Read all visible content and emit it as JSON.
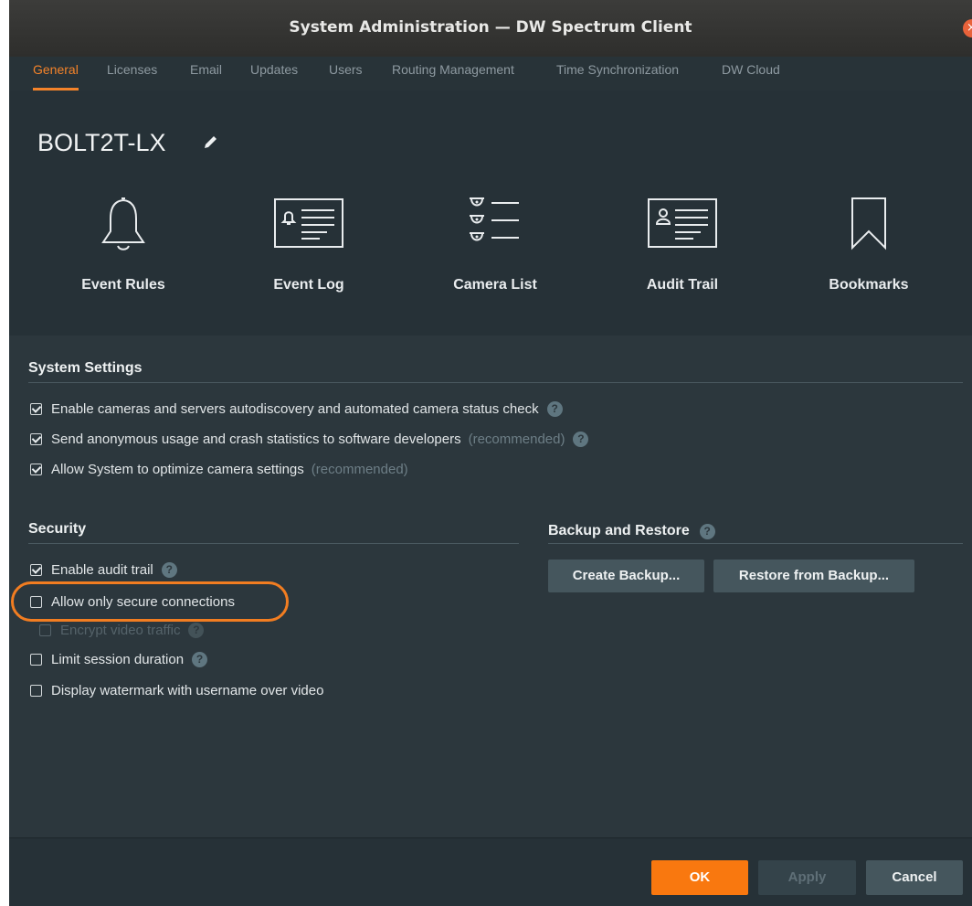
{
  "window": {
    "title": "System Administration — DW Spectrum Client",
    "close_glyph": "×"
  },
  "tabs": [
    {
      "label": "General",
      "active": true
    },
    {
      "label": "Licenses"
    },
    {
      "label": "Email"
    },
    {
      "label": "Updates"
    },
    {
      "label": "Users"
    },
    {
      "label": "Routing Management"
    },
    {
      "label": "Time Synchronization"
    },
    {
      "label": "DW Cloud"
    }
  ],
  "header": {
    "system_name": "BOLT2T-LX",
    "tiles": [
      {
        "label": "Event Rules",
        "icon": "bell-icon"
      },
      {
        "label": "Event Log",
        "icon": "event-log-icon"
      },
      {
        "label": "Camera List",
        "icon": "camera-list-icon"
      },
      {
        "label": "Audit Trail",
        "icon": "audit-trail-icon"
      },
      {
        "label": "Bookmarks",
        "icon": "bookmark-icon"
      }
    ]
  },
  "system_settings": {
    "title": "System Settings",
    "items": [
      {
        "label": "Enable cameras and servers autodiscovery and automated camera status check",
        "checked": true,
        "help": true
      },
      {
        "label": "Send anonymous usage and crash statistics to software developers",
        "note": "(recommended)",
        "checked": true,
        "help": true
      },
      {
        "label": "Allow System to optimize camera settings",
        "note": "(recommended)",
        "checked": true
      }
    ]
  },
  "security": {
    "title": "Security",
    "items": [
      {
        "label": "Enable audit trail",
        "checked": true,
        "help": true
      },
      {
        "label": "Allow only secure connections",
        "checked": false,
        "highlighted": true
      },
      {
        "label": "Encrypt video traffic",
        "checked": false,
        "disabled": true,
        "help": true
      },
      {
        "label": "Limit session duration",
        "checked": false,
        "help": true
      },
      {
        "label": "Display watermark with username over video",
        "checked": false
      }
    ]
  },
  "backup": {
    "title": "Backup and Restore",
    "create_label": "Create Backup...",
    "restore_label": "Restore from Backup..."
  },
  "footer": {
    "ok_label": "OK",
    "apply_label": "Apply",
    "cancel_label": "Cancel"
  },
  "help_glyph": "?",
  "colors": {
    "accent": "#f4832a",
    "background": "#263137",
    "panel": "#2c373d",
    "button": "#45565d"
  }
}
